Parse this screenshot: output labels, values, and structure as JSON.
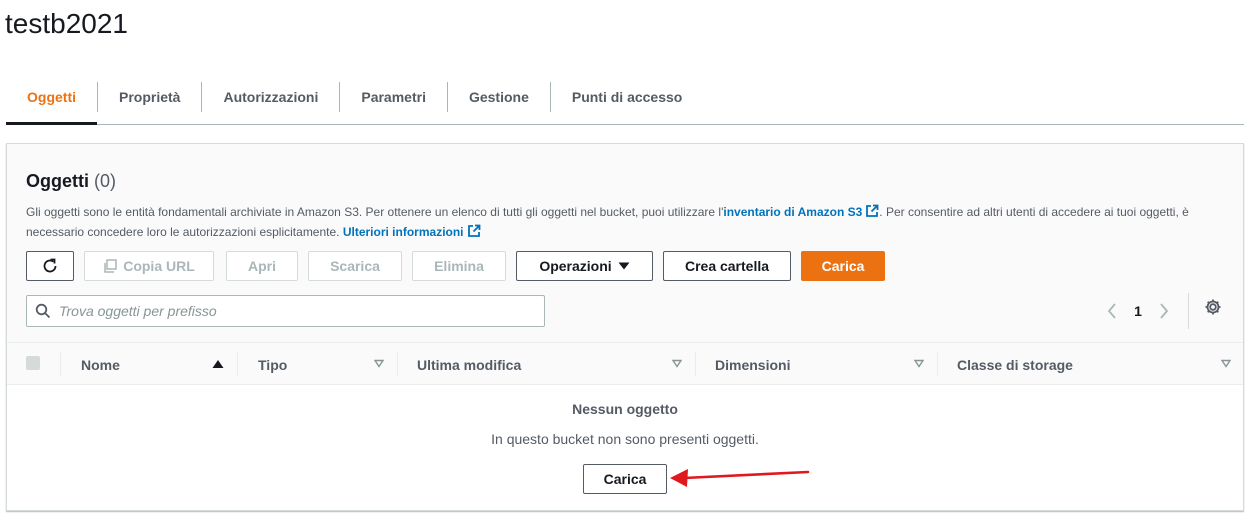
{
  "bucket": {
    "name": "testb2021"
  },
  "tabs": [
    {
      "label": "Oggetti",
      "active": true
    },
    {
      "label": "Proprietà",
      "active": false
    },
    {
      "label": "Autorizzazioni",
      "active": false
    },
    {
      "label": "Parametri",
      "active": false
    },
    {
      "label": "Gestione",
      "active": false
    },
    {
      "label": "Punti di accesso",
      "active": false
    }
  ],
  "objects_panel": {
    "title": "Oggetti",
    "count": "(0)",
    "description_1": "Gli oggetti sono le entità fondamentali archiviate in Amazon S3. Per ottenere un elenco di tutti gli oggetti nel bucket, puoi utilizzare l'",
    "description_link": "inventario di Amazon S3",
    "description_2": ". Per consentire ad altri utenti di accedere ai tuoi oggetti, è necessario concedere loro le autorizzazioni esplicitamente.",
    "learn_more": "Ulteriori informazioni"
  },
  "toolbar": {
    "refresh_icon": "refresh-icon",
    "copy_url": "Copia URL",
    "open": "Apri",
    "download": "Scarica",
    "delete": "Elimina",
    "actions": "Operazioni",
    "create_folder": "Crea cartella",
    "upload": "Carica"
  },
  "search": {
    "placeholder": "Trova oggetti per prefisso",
    "value": ""
  },
  "pagination": {
    "current_page": "1"
  },
  "table": {
    "columns": [
      "Nome",
      "Tipo",
      "Ultima modifica",
      "Dimensioni",
      "Classe di storage"
    ]
  },
  "empty_state": {
    "title": "Nessun oggetto",
    "message": "In questo bucket non sono presenti oggetti.",
    "upload": "Carica"
  },
  "colors": {
    "accent": "#ec7211",
    "link": "#0073bb",
    "annotation_arrow": "#e0191e"
  }
}
